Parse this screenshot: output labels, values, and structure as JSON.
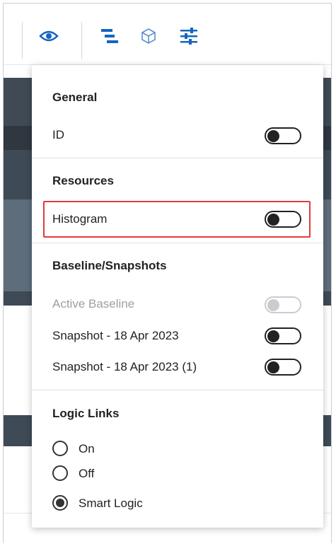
{
  "toolbar": {
    "icons": [
      "eye-icon",
      "gantt-bars-icon",
      "cube-icon",
      "sliders-icon"
    ],
    "accent_color": "#1565c0"
  },
  "panel": {
    "general": {
      "heading": "General",
      "items": [
        {
          "label": "ID",
          "on": false,
          "enabled": true
        }
      ]
    },
    "resources": {
      "heading": "Resources",
      "items": [
        {
          "label": "Histogram",
          "on": false,
          "enabled": true,
          "highlighted": true
        }
      ]
    },
    "baseline": {
      "heading": "Baseline/Snapshots",
      "items": [
        {
          "label": "Active Baseline",
          "on": false,
          "enabled": false
        },
        {
          "label": "Snapshot - 18 Apr 2023",
          "on": false,
          "enabled": true
        },
        {
          "label": "Snapshot - 18 Apr 2023 (1)",
          "on": false,
          "enabled": true
        }
      ]
    },
    "logic_links": {
      "heading": "Logic Links",
      "options": [
        {
          "label": "On",
          "checked": false
        },
        {
          "label": "Off",
          "checked": false
        },
        {
          "label": "Smart Logic",
          "checked": true
        }
      ]
    },
    "highlight_color": "#e23b3b"
  }
}
